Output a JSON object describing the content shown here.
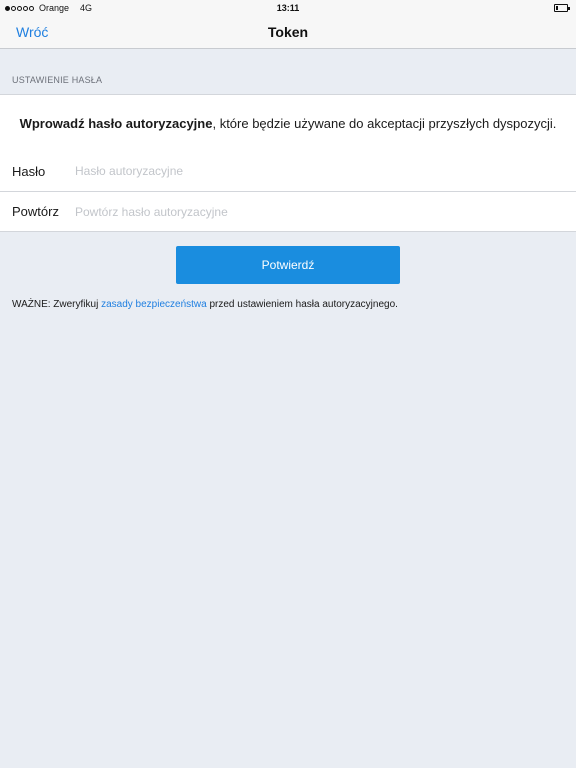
{
  "status_bar": {
    "carrier": "Orange",
    "network": "4G",
    "time": "13:11",
    "signal_strength": 1,
    "battery_level": 0.1
  },
  "nav": {
    "back_label": "Wróć",
    "title": "Token"
  },
  "section": {
    "header": "USTAWIENIE HASŁA"
  },
  "info": {
    "bold_text": "Wprowadź hasło autoryzacyjne",
    "rest_text": ", które będzie używane do akceptacji przyszłych dyspozycji."
  },
  "form": {
    "password": {
      "label": "Hasło",
      "value": "",
      "placeholder": "Hasło autoryzacyjne"
    },
    "repeat": {
      "label": "Powtórz",
      "value": "",
      "placeholder": "Powtórz hasło autoryzacyjne"
    }
  },
  "actions": {
    "confirm_label": "Potwierdź"
  },
  "note": {
    "prefix": "WAŻNE: Zweryfikuj ",
    "link": "zasady bezpieczeństwa",
    "suffix": " przed ustawieniem hasła autoryzacyjnego."
  },
  "colors": {
    "accent": "#1a8ddf",
    "link": "#1f7fe0",
    "background": "#e9edf3"
  }
}
